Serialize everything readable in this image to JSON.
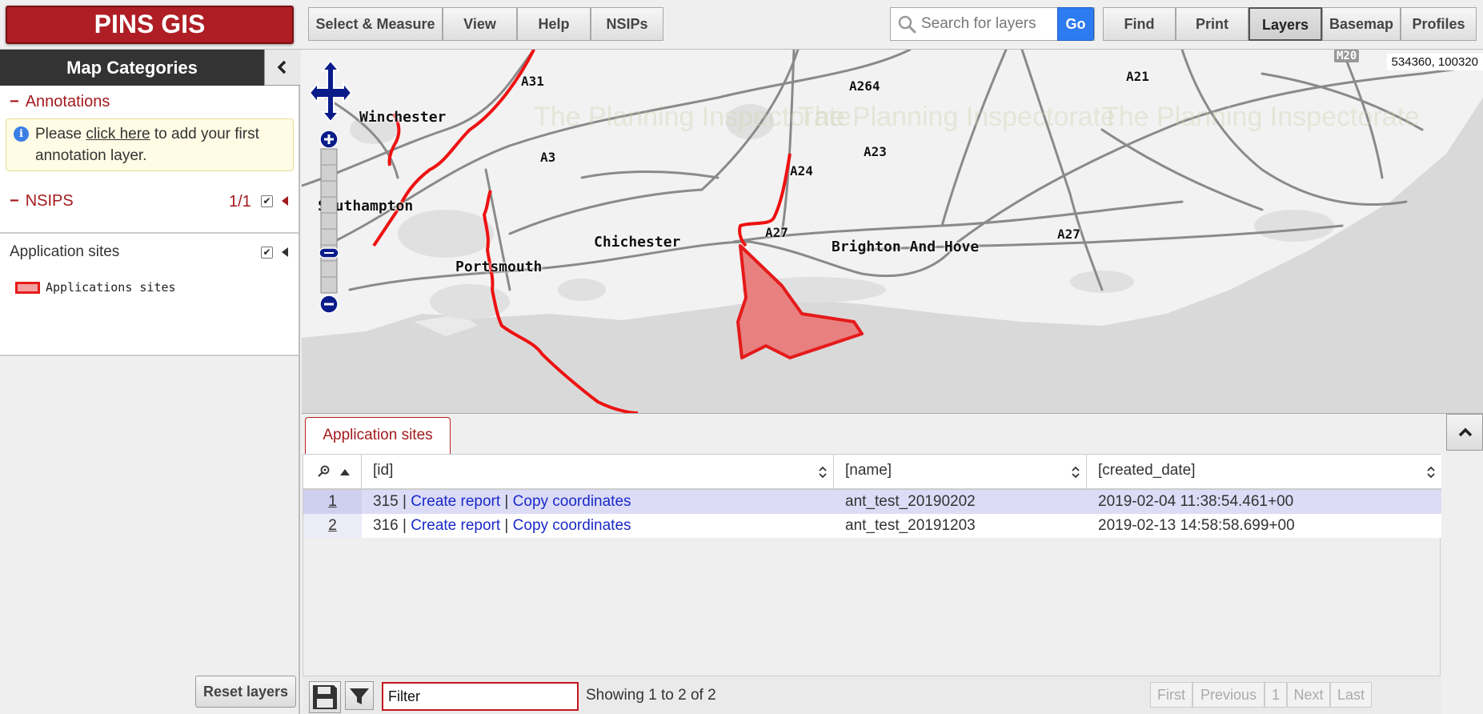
{
  "app": {
    "logo": "PINS GIS"
  },
  "toolbar": {
    "select_measure": "Select & Measure",
    "view": "View",
    "help": "Help",
    "nsips": "NSIPs",
    "search_placeholder": "Search for layers",
    "go": "Go",
    "find": "Find",
    "print": "Print",
    "layers": "Layers",
    "basemap": "Basemap",
    "profiles": "Profiles",
    "active_tab": "Layers"
  },
  "sidebar": {
    "title": "Map Categories",
    "annotations": {
      "title": "Annotations",
      "info_prefix": "Please ",
      "info_link": "click here",
      "info_suffix": " to add your first annotation layer."
    },
    "nsips": {
      "title": "NSIPS",
      "count": "1/1",
      "layer_label": "Application sites",
      "legend_label": "Applications sites"
    },
    "reset_label": "Reset layers"
  },
  "map": {
    "coordinates": "534360, 100320",
    "places": [
      "Winchester",
      "Southampton",
      "Portsmouth",
      "Chichester",
      "Brighton And Hove"
    ],
    "roads": [
      "A31",
      "A3",
      "A264",
      "A23",
      "A24",
      "A27",
      "A27",
      "A21",
      "M20"
    ],
    "watermark": "The Planning Inspectorate"
  },
  "results": {
    "tab_label": "Application sites",
    "columns": [
      "[id]",
      "[name]",
      "[created_date]"
    ],
    "rows": [
      {
        "num": "1",
        "id": "315",
        "create_report": "Create report",
        "copy_coords": "Copy coordinates",
        "name": "ant_test_20190202",
        "created": "2019-02-04 11:38:54.461+00"
      },
      {
        "num": "2",
        "id": "316",
        "create_report": "Create report",
        "copy_coords": "Copy coordinates",
        "name": "ant_test_20191203",
        "created": "2019-02-13 14:58:58.699+00"
      }
    ],
    "filter_placeholder": "Filter",
    "paging_info": "Showing 1 to 2 of 2",
    "pager": {
      "first": "First",
      "previous": "Previous",
      "page": "1",
      "next": "Next",
      "last": "Last"
    }
  },
  "colors": {
    "brand": "#ae1e24",
    "accent": "#2d7bf0",
    "site_stroke": "#e51a1a",
    "site_fill": "#e88080",
    "row_highlight": "#dcdcf7"
  }
}
